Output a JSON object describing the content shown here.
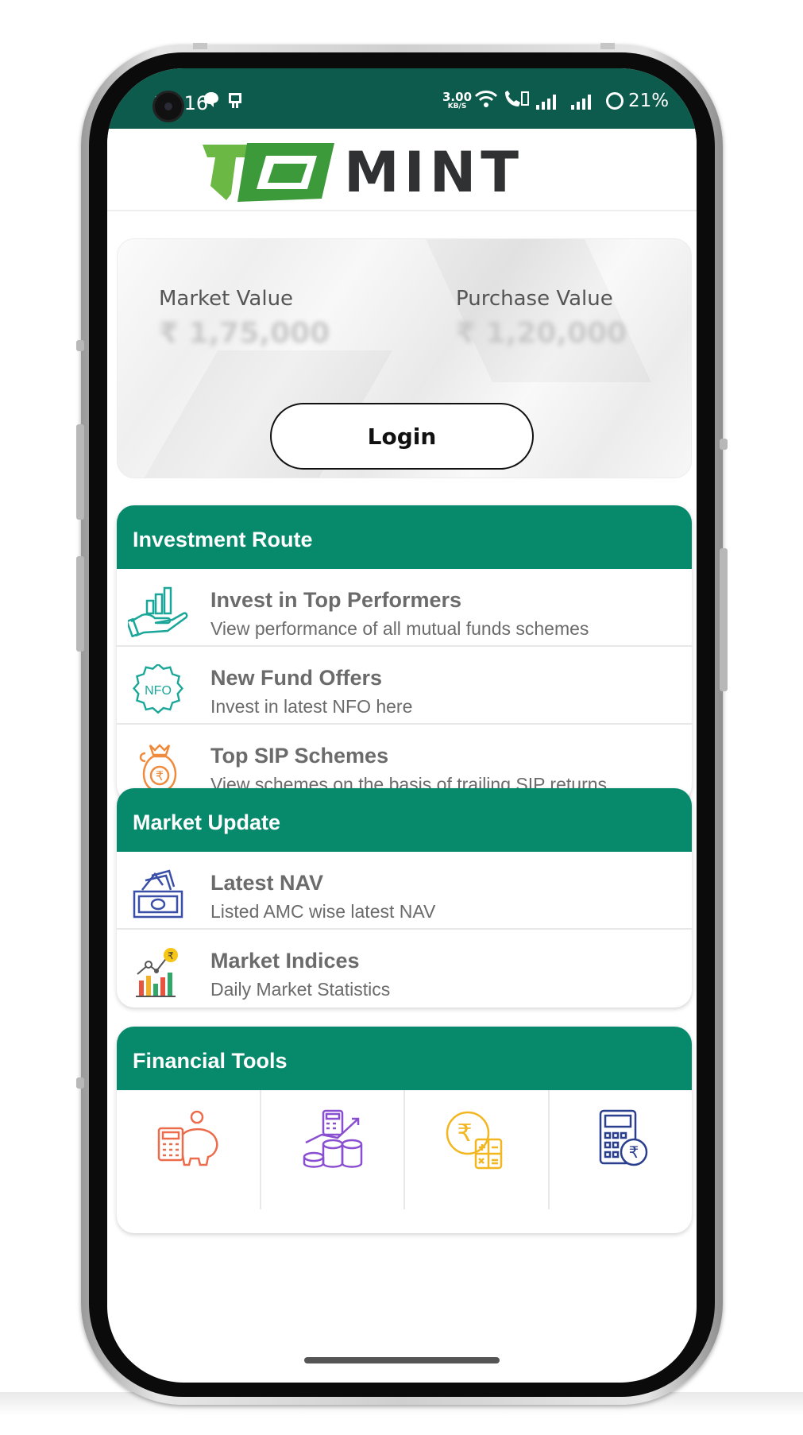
{
  "status_bar": {
    "time": "11:16",
    "net_speed_value": "3.00",
    "net_speed_unit": "KB/S",
    "battery": "21%"
  },
  "header": {
    "logo_text": "MINT"
  },
  "portfolio": {
    "market_value_label": "Market Value",
    "market_value": "₹ 1,75,000",
    "purchase_value_label": "Purchase Value",
    "purchase_value": "₹ 1,20,000",
    "login_label": "Login"
  },
  "investment_route": {
    "title": "Investment Route",
    "items": [
      {
        "title": "Invest in Top Performers",
        "subtitle": "View performance of all mutual funds schemes",
        "icon": "hand-chart-icon"
      },
      {
        "title": "New Fund Offers",
        "subtitle": "Invest in latest NFO here",
        "icon": "nfo-badge-icon"
      },
      {
        "title": "Top SIP Schemes",
        "subtitle": "View schemes on the basis of trailing SIP returns",
        "icon": "money-bag-icon"
      }
    ]
  },
  "market_update": {
    "title": "Market Update",
    "items": [
      {
        "title": "Latest NAV",
        "subtitle": "Listed AMC wise latest NAV",
        "icon": "cash-stack-icon"
      },
      {
        "title": "Market Indices",
        "subtitle": "Daily Market Statistics",
        "icon": "bar-chart-icon"
      }
    ]
  },
  "financial_tools": {
    "title": "Financial Tools",
    "items": [
      {
        "icon": "calculator-piggy-bank-icon"
      },
      {
        "icon": "calculator-coins-icon"
      },
      {
        "icon": "rupee-calculator-icon"
      },
      {
        "icon": "calculator-rupee-icon"
      }
    ]
  },
  "colors": {
    "status_bar": "#0c5b4c",
    "section_header": "#078a6c",
    "logo_green": "#5fb346"
  }
}
